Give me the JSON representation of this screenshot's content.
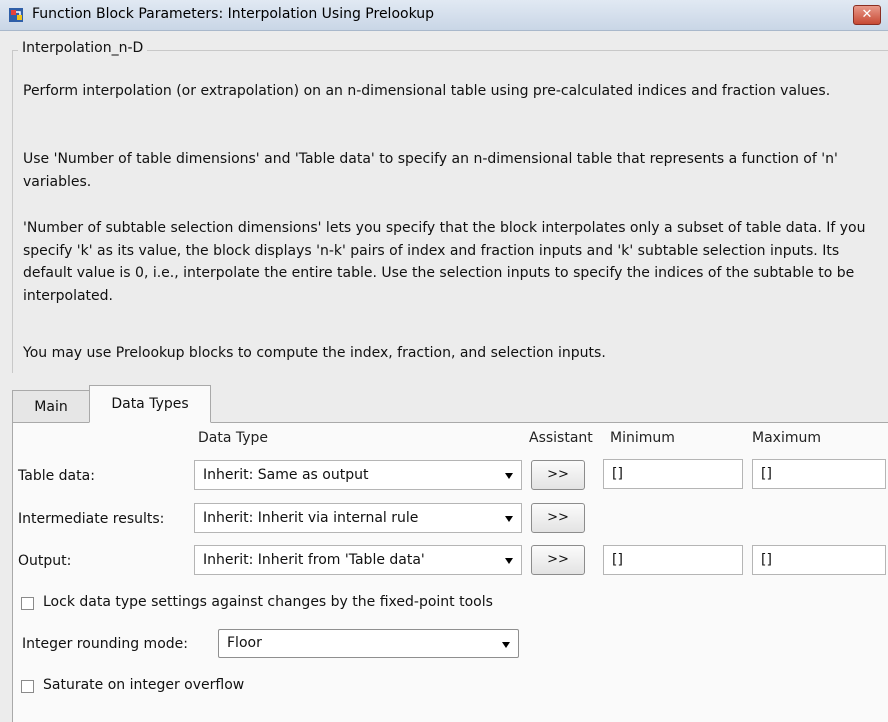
{
  "window": {
    "title": "Function Block Parameters: Interpolation Using Prelookup",
    "close_symbol": "✕"
  },
  "group": {
    "title": "Interpolation_n-D",
    "paragraphs": [
      "Perform interpolation (or extrapolation) on an n-dimensional table using pre-calculated indices and fraction values.",
      "Use 'Number of table dimensions' and 'Table data' to specify an n-dimensional table that represents a function of 'n' variables.",
      "'Number of subtable selection dimensions' lets you specify that the block interpolates only a subset of table data. If you specify 'k' as its value, the block displays 'n-k' pairs of index and fraction inputs and 'k' subtable selection inputs. Its default value is 0, i.e., interpolate the entire table. Use the selection inputs to specify the indices of the subtable to be interpolated.",
      "You may use Prelookup blocks to compute the index, fraction, and selection inputs."
    ]
  },
  "tabs": [
    {
      "label": "Main",
      "active": false
    },
    {
      "label": "Data Types",
      "active": true
    }
  ],
  "table": {
    "headers": {
      "data_type": "Data Type",
      "assistant": "Assistant",
      "minimum": "Minimum",
      "maximum": "Maximum"
    },
    "rows": [
      {
        "label": "Table data:",
        "data_type": "Inherit: Same as output",
        "assistant": ">>",
        "minimum": "[]",
        "maximum": "[]"
      },
      {
        "label": "Intermediate results:",
        "data_type": "Inherit: Inherit via internal rule",
        "assistant": ">>"
      },
      {
        "label": "Output:",
        "data_type": "Inherit: Inherit from 'Table data'",
        "assistant": ">>",
        "minimum": "[]",
        "maximum": "[]"
      }
    ]
  },
  "lock_checkbox": {
    "label": "Lock data type settings against changes by the fixed-point tools",
    "checked": false
  },
  "rounding": {
    "label": "Integer rounding mode:",
    "value": "Floor"
  },
  "saturate_checkbox": {
    "label": "Saturate on integer overflow",
    "checked": false
  },
  "colors": {
    "titlebar": "#c9d6e6",
    "close": "#c74a34",
    "panel": "#fafafa",
    "background": "#ececec"
  }
}
